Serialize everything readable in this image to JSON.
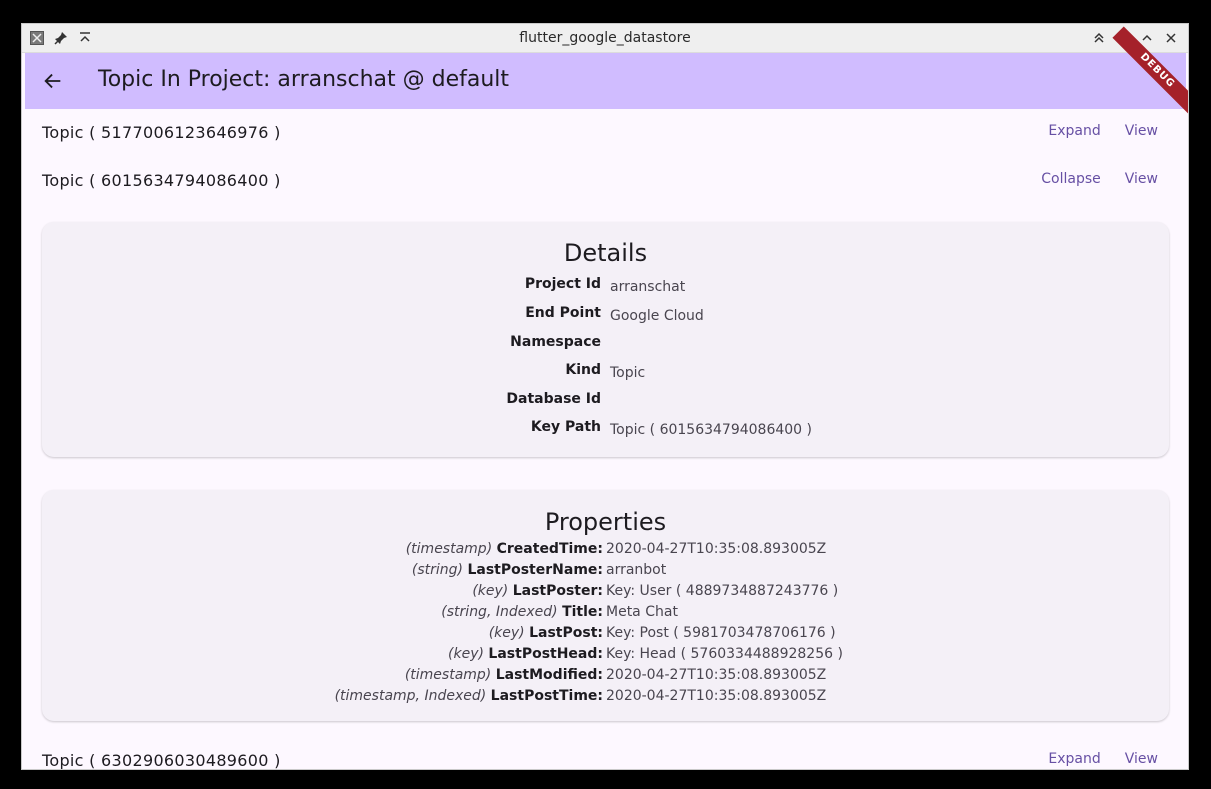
{
  "window": {
    "title": "flutter_google_datastore"
  },
  "appbar": {
    "title": "Topic In Project: arranschat @ default",
    "debug_label": "DEBUG"
  },
  "topics": [
    {
      "label": "Topic ( 5177006123646976 )",
      "toggle": "Expand",
      "view": "View"
    },
    {
      "label": "Topic ( 6015634794086400 )",
      "toggle": "Collapse",
      "view": "View"
    },
    {
      "label": "Topic ( 6302906030489600 )",
      "toggle": "Expand",
      "view": "View"
    }
  ],
  "details": {
    "title": "Details",
    "rows": [
      {
        "key": "Project Id",
        "value": "arranschat"
      },
      {
        "key": "End Point",
        "value": "Google Cloud"
      },
      {
        "key": "Namespace",
        "value": ""
      },
      {
        "key": "Kind",
        "value": "Topic"
      },
      {
        "key": "Database Id",
        "value": ""
      },
      {
        "key": "Key Path",
        "value": "Topic ( 6015634794086400 )"
      }
    ]
  },
  "properties": {
    "title": "Properties",
    "rows": [
      {
        "type": "(timestamp)",
        "name": "CreatedTime:",
        "value": "2020-04-27T10:35:08.893005Z"
      },
      {
        "type": "(string)",
        "name": "LastPosterName:",
        "value": "arranbot"
      },
      {
        "type": "(key)",
        "name": "LastPoster:",
        "value": "Key: User ( 4889734887243776 )"
      },
      {
        "type": "(string, Indexed)",
        "name": "Title:",
        "value": "Meta Chat"
      },
      {
        "type": "(key)",
        "name": "LastPost:",
        "value": "Key: Post ( 5981703478706176 )"
      },
      {
        "type": "(key)",
        "name": "LastPostHead:",
        "value": "Key: Head ( 5760334488928256 )"
      },
      {
        "type": "(timestamp)",
        "name": "LastModified:",
        "value": "2020-04-27T10:35:08.893005Z"
      },
      {
        "type": "(timestamp, Indexed)",
        "name": "LastPostTime:",
        "value": "2020-04-27T10:35:08.893005Z"
      }
    ]
  },
  "colors": {
    "appbar": "#d0bcff",
    "accent": "#6750a4",
    "background": "#fdf8ff",
    "card": "#f4f0f7",
    "debug": "#a5212a"
  }
}
